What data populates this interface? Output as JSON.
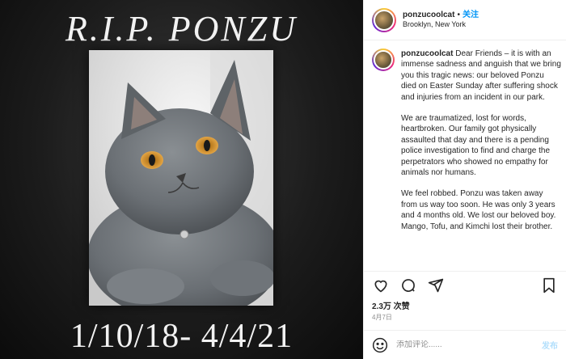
{
  "memorial": {
    "title": "R.I.P. PONZU",
    "dates": "1/10/18- 4/4/21"
  },
  "header": {
    "username": "ponzucoolcat",
    "separator": "•",
    "follow_label": "关注",
    "location": "Brooklyn, New York"
  },
  "caption": {
    "username": "ponzucoolcat",
    "paragraphs": [
      "Dear Friends – it is with an immense sadness and anguish that we bring you this tragic news: our beloved Ponzu died on Easter Sunday after suffering shock and injuries from an incident in our park.",
      "We are traumatized, lost for words, heartbroken. Our family got physically assaulted that day and there is a pending police investigation to find and charge the perpetrators who showed no empathy for animals nor humans.",
      "We feel robbed. Ponzu was taken away from us way too soon. He was only 3 years and 4 months old. We lost our beloved boy. Mango, Tofu, and Kimchi lost their brother."
    ]
  },
  "actions": {
    "like_icon": "heart-icon",
    "comment_icon": "comment-icon",
    "share_icon": "share-icon",
    "save_icon": "bookmark-icon"
  },
  "stats": {
    "likes": "2.3万 次赞",
    "date": "4月7日"
  },
  "comment": {
    "placeholder": "添加评论......",
    "post_label": "发布"
  },
  "colors": {
    "accent": "#0095f6",
    "post_disabled": "#b2dffc",
    "memorial_bg": "#1c1c1c"
  }
}
